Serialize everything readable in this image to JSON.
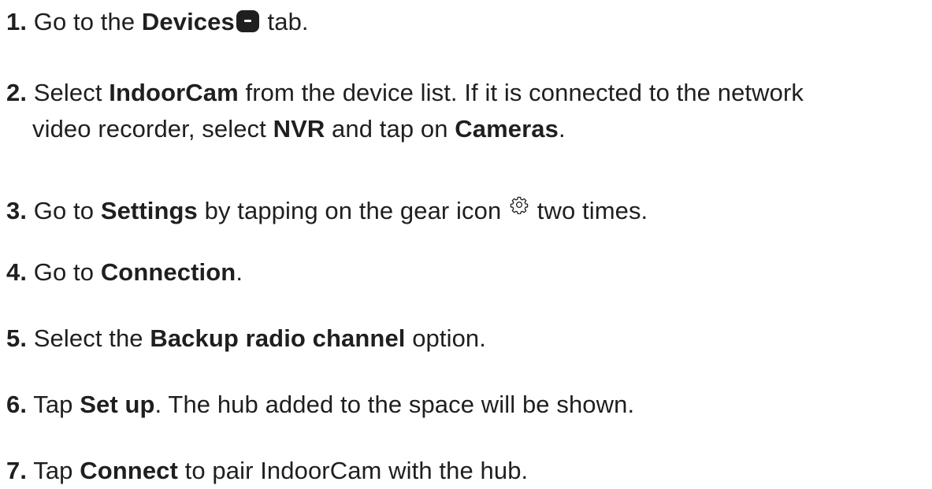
{
  "steps": [
    {
      "num": "1.",
      "parts": [
        {
          "t": "text",
          "v": " Go to the "
        },
        {
          "t": "bold",
          "v": "Devices"
        },
        {
          "t": "icon",
          "name": "devices-tab-icon"
        },
        {
          "t": "text",
          "v": " tab."
        }
      ]
    },
    {
      "num": "2.",
      "parts": [
        {
          "t": "text",
          "v": " Select "
        },
        {
          "t": "bold",
          "v": "IndoorCam"
        },
        {
          "t": "text",
          "v": " from the device list. If it is connected to the network"
        }
      ],
      "cont": [
        {
          "t": "text",
          "v": "video recorder, select "
        },
        {
          "t": "bold",
          "v": "NVR"
        },
        {
          "t": "text",
          "v": " and tap on "
        },
        {
          "t": "bold",
          "v": "Cameras"
        },
        {
          "t": "text",
          "v": "."
        }
      ]
    },
    {
      "num": "3.",
      "parts": [
        {
          "t": "text",
          "v": " Go to "
        },
        {
          "t": "bold",
          "v": "Settings"
        },
        {
          "t": "text",
          "v": " by tapping on the gear icon "
        },
        {
          "t": "icon",
          "name": "gear-icon"
        },
        {
          "t": "text",
          "v": " two times."
        }
      ]
    },
    {
      "num": "4.",
      "parts": [
        {
          "t": "text",
          "v": " Go to "
        },
        {
          "t": "bold",
          "v": "Connection"
        },
        {
          "t": "text",
          "v": "."
        }
      ]
    },
    {
      "num": "5.",
      "parts": [
        {
          "t": "text",
          "v": " Select the "
        },
        {
          "t": "bold",
          "v": "Backup radio channel"
        },
        {
          "t": "text",
          "v": " option."
        }
      ]
    },
    {
      "num": "6.",
      "parts": [
        {
          "t": "text",
          "v": " Tap "
        },
        {
          "t": "bold",
          "v": "Set up"
        },
        {
          "t": "text",
          "v": ". The hub added to the space will be shown."
        }
      ]
    },
    {
      "num": "7.",
      "parts": [
        {
          "t": "text",
          "v": " Tap "
        },
        {
          "t": "bold",
          "v": "Connect"
        },
        {
          "t": "text",
          "v": " to pair IndoorCam with the hub."
        }
      ]
    }
  ]
}
